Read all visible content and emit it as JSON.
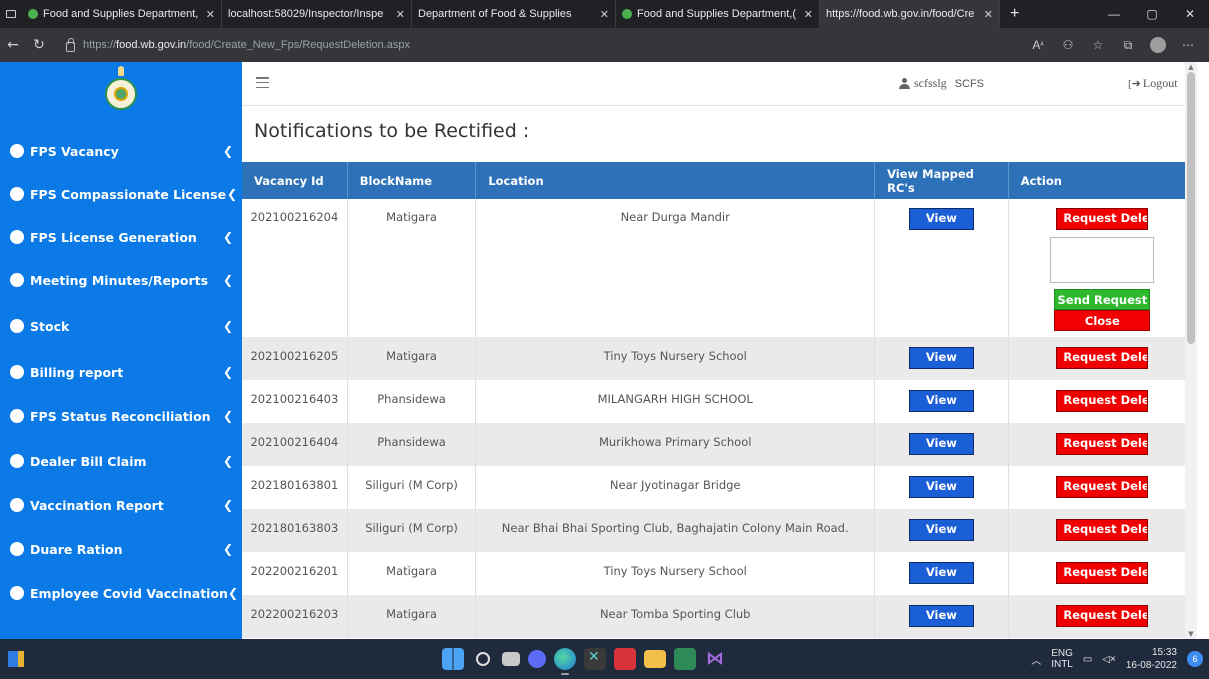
{
  "browser": {
    "tabs": [
      {
        "title": "Food and Supplies Department,(",
        "favicon_color": "#4caf50",
        "active": false
      },
      {
        "title": "localhost:58029/Inspector/Inspe",
        "favicon_color": "",
        "active": false
      },
      {
        "title": "Department of Food & Supplies",
        "favicon_color": "",
        "active": false
      },
      {
        "title": "Food and Supplies Department,(",
        "favicon_color": "#4caf50",
        "active": false
      },
      {
        "title": "https://food.wb.gov.in/food/Cre",
        "favicon_color": "",
        "active": true
      }
    ],
    "address": {
      "prefix": "https://",
      "host": "food.wb.gov.in",
      "path": "/food/Create_New_Fps/RequestDeletion.aspx"
    }
  },
  "sidebar": {
    "accent": "#0b7ae6",
    "items": [
      {
        "label": "FPS Vacancy"
      },
      {
        "label": "FPS Compassionate License"
      },
      {
        "label": "FPS License Generation"
      },
      {
        "label": "Meeting Minutes/Reports"
      },
      {
        "label": "Stock"
      },
      {
        "label": "Billing report"
      },
      {
        "label": "FPS Status Reconciliation"
      },
      {
        "label": "Dealer Bill Claim"
      },
      {
        "label": "Vaccination Report"
      },
      {
        "label": "Duare Ration"
      },
      {
        "label": "Employee Covid Vaccination"
      }
    ]
  },
  "header": {
    "username": "scfsslg",
    "role": "SCFS",
    "logout_label": "Logout"
  },
  "main": {
    "title": "Notifications to be Rectified :",
    "table": {
      "columns": [
        "Vacancy Id",
        "BlockName",
        "Location",
        "View Mapped RC's",
        "Action"
      ],
      "view_label": "View",
      "delete_label": "Request Deletion",
      "send_label": "Send Request",
      "close_label": "Close",
      "rows": [
        {
          "id": "202100216204",
          "block": "Matigara",
          "location": "Near Durga Mandir"
        },
        {
          "id": "202100216205",
          "block": "Matigara",
          "location": "Tiny Toys Nursery School"
        },
        {
          "id": "202100216403",
          "block": "Phansidewa",
          "location": "MILANGARH HIGH SCHOOL"
        },
        {
          "id": "202100216404",
          "block": "Phansidewa",
          "location": "Murikhowa Primary School"
        },
        {
          "id": "202180163801",
          "block": "Siliguri (M Corp)",
          "location": "Near Jyotinagar Bridge"
        },
        {
          "id": "202180163803",
          "block": "Siliguri (M Corp)",
          "location": "Near Bhai Bhai Sporting Club, Baghajatin Colony Main Road."
        },
        {
          "id": "202200216201",
          "block": "Matigara",
          "location": "Tiny Toys Nursery School"
        },
        {
          "id": "202200216203",
          "block": "Matigara",
          "location": "Near Tomba Sporting Club"
        }
      ]
    }
  },
  "taskbar": {
    "lang_top": "ENG",
    "lang_bottom": "INTL",
    "time": "15:33",
    "date": "16-08-2022",
    "notification_count": "6"
  }
}
